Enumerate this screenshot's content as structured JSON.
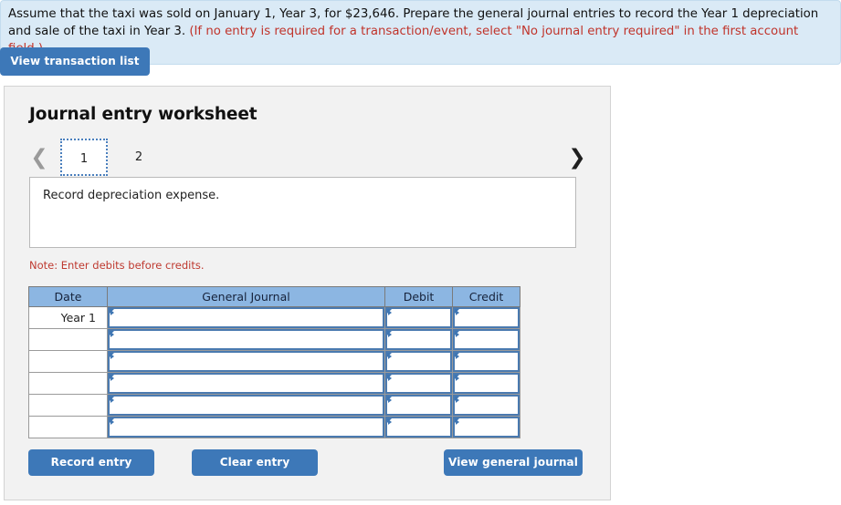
{
  "banner": {
    "text_black_1": "Assume that the taxi was sold on January 1, Year 3, for $23,646. Prepare the general journal entries to record the Year 1 depreciation and sale of the taxi in Year 3. ",
    "text_red": "(If no entry is required for a transaction/event, select \"No journal entry required\" in the first account field.)"
  },
  "toolbar": {
    "view_transaction_list_label": "View transaction list"
  },
  "worksheet": {
    "title": "Journal entry worksheet",
    "pager": {
      "prev_icon": "chevron-left-icon",
      "next_icon": "chevron-right-icon",
      "tabs": [
        {
          "label": "1",
          "active": true
        },
        {
          "label": "2",
          "active": false
        }
      ]
    },
    "description": "Record depreciation expense.",
    "note": "Note: Enter debits before credits.",
    "table": {
      "headers": [
        "Date",
        "General Journal",
        "Debit",
        "Credit"
      ],
      "rows": [
        {
          "date": "Year 1",
          "journal": "",
          "debit": "",
          "credit": ""
        },
        {
          "date": "",
          "journal": "",
          "debit": "",
          "credit": ""
        },
        {
          "date": "",
          "journal": "",
          "debit": "",
          "credit": ""
        },
        {
          "date": "",
          "journal": "",
          "debit": "",
          "credit": ""
        },
        {
          "date": "",
          "journal": "",
          "debit": "",
          "credit": ""
        },
        {
          "date": "",
          "journal": "",
          "debit": "",
          "credit": ""
        }
      ]
    },
    "actions": {
      "record_entry_label": "Record entry",
      "clear_entry_label": "Clear entry",
      "view_general_journal_label": "View general journal"
    }
  },
  "colors": {
    "button_blue": "#3d78b8",
    "banner_bg": "#daeaf6",
    "table_header_blue": "#8cb6e2",
    "note_red": "#bf3a30",
    "panel_bg": "#f2f2f2"
  }
}
